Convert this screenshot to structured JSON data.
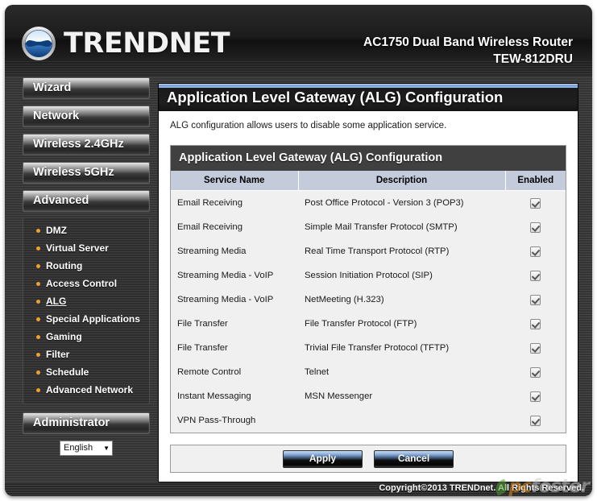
{
  "header": {
    "brand_name": "TRENDNET",
    "brand_logo_icon": "trendnet-wave-logo",
    "product_line": "AC1750 Dual Band Wireless Router",
    "model": "TEW-812DRU"
  },
  "sidebar": {
    "buttons": [
      {
        "label": "Wizard"
      },
      {
        "label": "Network"
      },
      {
        "label": "Wireless 2.4GHz"
      },
      {
        "label": "Wireless 5GHz"
      },
      {
        "label": "Advanced"
      }
    ],
    "submenu": [
      {
        "label": "DMZ",
        "active": false
      },
      {
        "label": "Virtual Server",
        "active": false
      },
      {
        "label": "Routing",
        "active": false
      },
      {
        "label": "Access Control",
        "active": false
      },
      {
        "label": "ALG",
        "active": true
      },
      {
        "label": "Special Applications",
        "active": false
      },
      {
        "label": "Gaming",
        "active": false
      },
      {
        "label": "Filter",
        "active": false
      },
      {
        "label": "Schedule",
        "active": false
      },
      {
        "label": "Advanced Network",
        "active": false
      }
    ],
    "admin_button": {
      "label": "Administrator"
    },
    "language": {
      "selected": "English",
      "caret_icon": "chevron-down-icon"
    }
  },
  "main": {
    "page_title": "Application Level Gateway (ALG) Configuration",
    "page_description": "ALG configuration allows users to disable some application service.",
    "table": {
      "caption": "Application Level Gateway (ALG) Configuration",
      "columns": [
        "Service Name",
        "Description",
        "Enabled"
      ],
      "rows": [
        {
          "service": "Email Receiving",
          "description": "Post Office Protocol - Version 3 (POP3)",
          "enabled": true
        },
        {
          "service": "Email Receiving",
          "description": "Simple Mail Transfer Protocol (SMTP)",
          "enabled": true
        },
        {
          "service": "Streaming Media",
          "description": "Real Time Transport Protocol (RTP)",
          "enabled": true
        },
        {
          "service": "Streaming Media - VoIP",
          "description": "Session Initiation Protocol (SIP)",
          "enabled": true
        },
        {
          "service": "Streaming Media - VoIP",
          "description": "NetMeeting (H.323)",
          "enabled": true
        },
        {
          "service": "File Transfer",
          "description": "File Transfer Protocol (FTP)",
          "enabled": true
        },
        {
          "service": "File Transfer",
          "description": "Trivial File Transfer Protocol (TFTP)",
          "enabled": true
        },
        {
          "service": "Remote Control",
          "description": "Telnet",
          "enabled": true
        },
        {
          "service": "Instant Messaging",
          "description": "MSN Messenger",
          "enabled": true
        },
        {
          "service": "VPN Pass-Through",
          "description": "",
          "enabled": true
        }
      ]
    },
    "actions": {
      "apply_label": "Apply",
      "cancel_label": "Cancel"
    }
  },
  "footer": {
    "copyright": "Copyright©2013 TRENDnet. All Rights Reserved."
  },
  "watermark": {
    "text_primary": "pc",
    "text_secondary": "foster"
  },
  "colors": {
    "chrome": "#3a3a3a",
    "title_accent": "#6d9ad8",
    "table_header": "#c4cbda",
    "row_background": "#f0f0f0",
    "bullet": "#f0a030"
  }
}
